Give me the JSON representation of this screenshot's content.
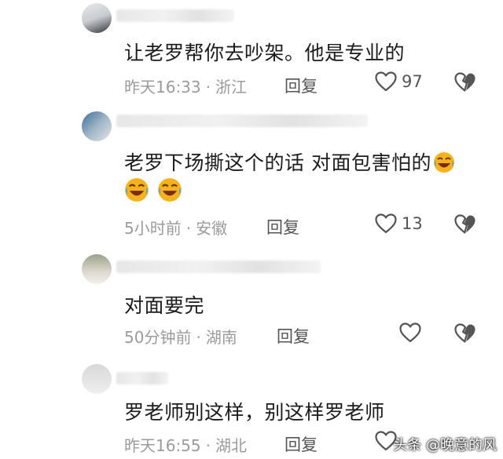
{
  "comments": [
    {
      "text": "让老罗帮你去吵架。他是专业的",
      "time": "昨天16:33",
      "location": "浙江",
      "reply_label": "回复",
      "likes": "97"
    },
    {
      "text": "老罗下场撕这个的话 对面包害怕的",
      "time": "5小时前",
      "location": "安徽",
      "reply_label": "回复",
      "likes": "13"
    },
    {
      "text": "对面要完",
      "time": "50分钟前",
      "location": "湖南",
      "reply_label": "回复",
      "likes": ""
    },
    {
      "text": "罗老师别这样，别这样罗老师",
      "time": "昨天16:55",
      "location": "湖北",
      "reply_label": "回复",
      "likes": ""
    }
  ],
  "separator": "·",
  "watermark": "头条 @晚意的风",
  "icons": {
    "like": "heart-outline-icon",
    "dislike": "broken-heart-icon",
    "emoji": "crying-laughing-emoji"
  },
  "colors": {
    "text": "#1b1b1b",
    "meta": "#9b9b9b",
    "icon": "#555555",
    "emoji": "#f6b21a"
  }
}
